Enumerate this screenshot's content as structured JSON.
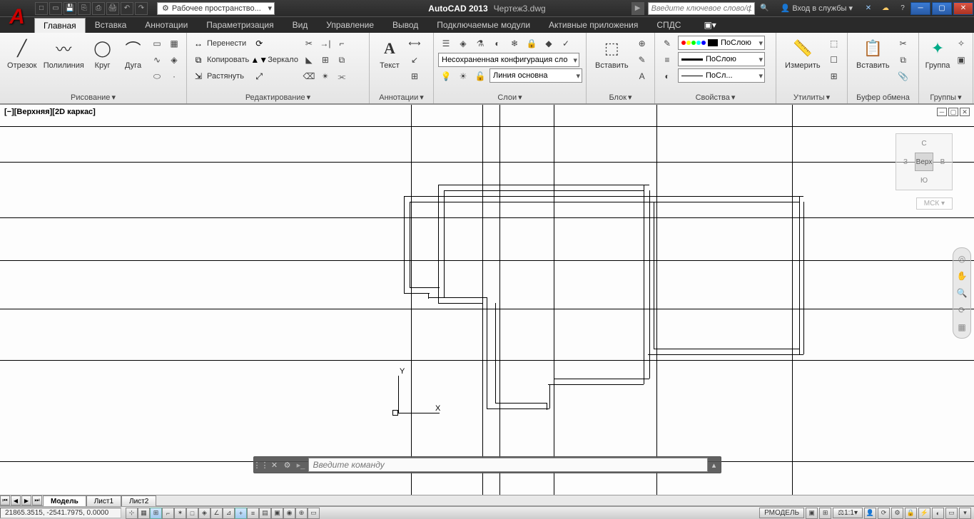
{
  "app": {
    "title": "AutoCAD 2013",
    "file": "Чертеж3.dwg",
    "workspace": "Рабочее пространство...",
    "search_ph": "Введите ключевое слово/фразу",
    "signin": "Вход в службы"
  },
  "tabs": [
    "Главная",
    "Вставка",
    "Аннотации",
    "Параметризация",
    "Вид",
    "Управление",
    "Вывод",
    "Подключаемые модули",
    "Активные приложения",
    "СПДС"
  ],
  "active_tab": 0,
  "panels": {
    "draw": {
      "title": "Рисование",
      "items": [
        "Отрезок",
        "Полилиния",
        "Круг",
        "Дуга"
      ]
    },
    "modify": {
      "title": "Редактирование",
      "move": "Перенести",
      "copy": "Копировать",
      "stretch": "Растянуть",
      "rotate": "",
      "mirror": "Зеркало"
    },
    "annot": {
      "title": "Аннотации",
      "text": "Текст"
    },
    "layers": {
      "title": "Слои",
      "config": "Несохраненная конфигурация сло",
      "linetype": "Линия основна"
    },
    "block": {
      "title": "Блок",
      "insert": "Вставить"
    },
    "props": {
      "title": "Свойства",
      "bylayer": "ПоСлою",
      "bylayer2": "ПоСлою",
      "bylayer3": "ПоСл..."
    },
    "utils": {
      "title": "Утилиты",
      "measure": "Измерить"
    },
    "clip": {
      "title": "Буфер обмена",
      "paste": "Вставить"
    },
    "groups": {
      "title": "Группы",
      "group": "Группа"
    }
  },
  "viewport": {
    "label": "[−][Верхняя][2D каркас]",
    "cube": {
      "n": "С",
      "s": "Ю",
      "e": "В",
      "w": "З",
      "top": "Верх"
    },
    "mck": "МСК"
  },
  "cmdline": {
    "ph": "Введите команду"
  },
  "doctabs": [
    "Модель",
    "Лист1",
    "Лист2"
  ],
  "status": {
    "coords": "21865.3515, -2541.7975, 0.0000",
    "model": "РМОДЕЛЬ",
    "scale": "1:1"
  }
}
